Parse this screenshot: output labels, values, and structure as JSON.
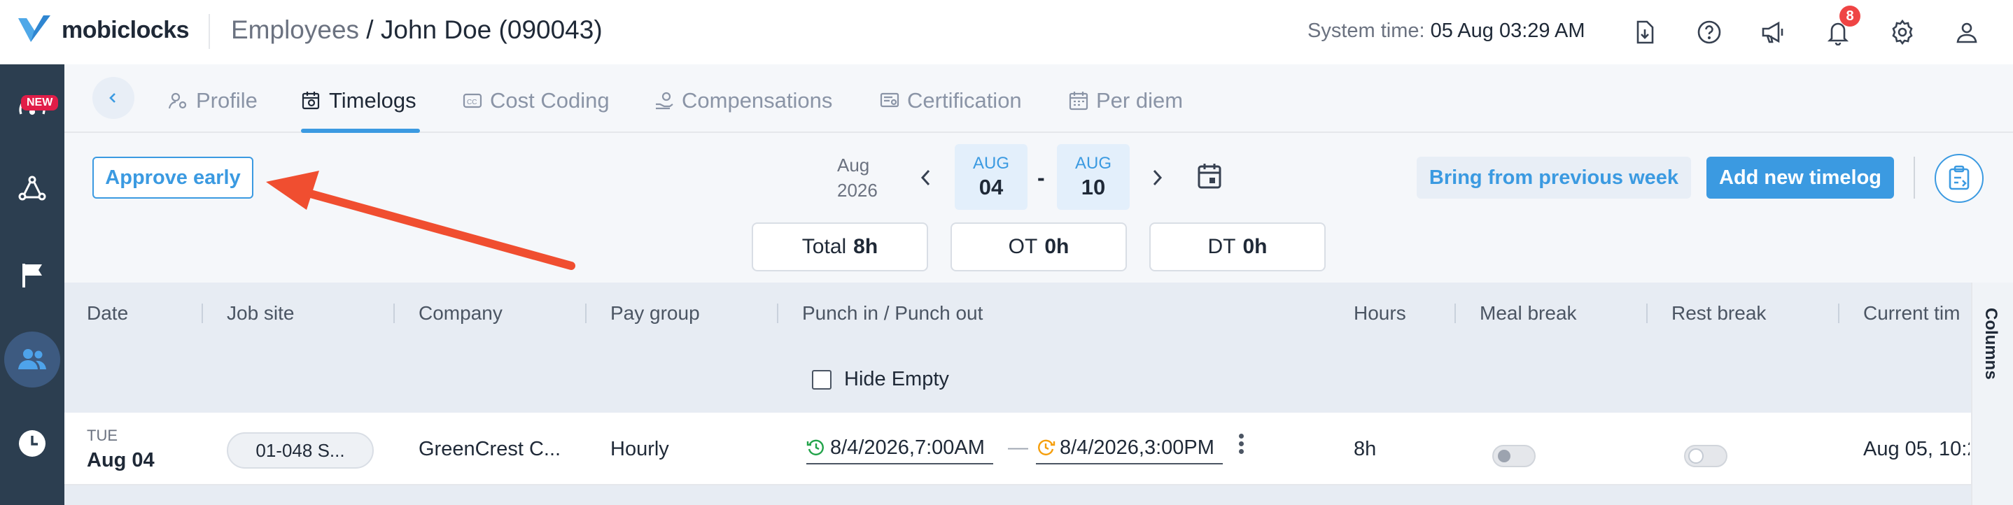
{
  "header": {
    "logo_text": "mobiclocks",
    "breadcrumb_parent": "Employees",
    "breadcrumb_sep": " / ",
    "breadcrumb_current": "John Doe (090043)",
    "system_time_label": "System time:",
    "system_time_value": "05 Aug 03:29 AM",
    "notification_count": "8"
  },
  "sidebar": {
    "new_tag": "NEW"
  },
  "tabs": [
    {
      "label": "Profile",
      "icon": "user-gear-icon"
    },
    {
      "label": "Timelogs",
      "icon": "timelog-icon"
    },
    {
      "label": "Cost Coding",
      "icon": "cc-icon"
    },
    {
      "label": "Compensations",
      "icon": "hand-coin-icon"
    },
    {
      "label": "Certification",
      "icon": "certificate-icon"
    },
    {
      "label": "Per diem",
      "icon": "calendar-icon"
    }
  ],
  "active_tab": "Timelogs",
  "toolbar": {
    "approve_early": "Approve early",
    "month_label": "Aug",
    "year_label": "2026",
    "start_month": "AUG",
    "start_day": "04",
    "range_sep": "-",
    "end_month": "AUG",
    "end_day": "10",
    "bring_previous": "Bring from previous week",
    "add_new": "Add new timelog"
  },
  "summary": {
    "total_label": "Total",
    "total_value": "8h",
    "ot_label": "OT",
    "ot_value": "0h",
    "dt_label": "DT",
    "dt_value": "0h"
  },
  "table": {
    "columns": [
      "Date",
      "Job site",
      "Company",
      "Pay group",
      "Punch in / Punch out",
      "Hours",
      "Meal break",
      "Rest break",
      "Current tim"
    ],
    "hide_empty_label": "Hide Empty",
    "columns_button": "Columns",
    "rows": [
      {
        "day": "TUE",
        "date": "Aug 04",
        "job_site": "01-048 S...",
        "company": "GreenCrest C...",
        "pay_group": "Hourly",
        "punch_in": "8/4/2026,7:00AM",
        "punch_sep": "—",
        "punch_out": "8/4/2026,3:00PM",
        "hours": "8h",
        "meal_break": false,
        "rest_break": false,
        "current_time": "Aug 05, 10:2"
      }
    ]
  },
  "colors": {
    "accent": "#3b9ae1",
    "sidebar": "#2c3e50",
    "annotation_arrow": "#f04e30",
    "badge": "#ef4444"
  }
}
